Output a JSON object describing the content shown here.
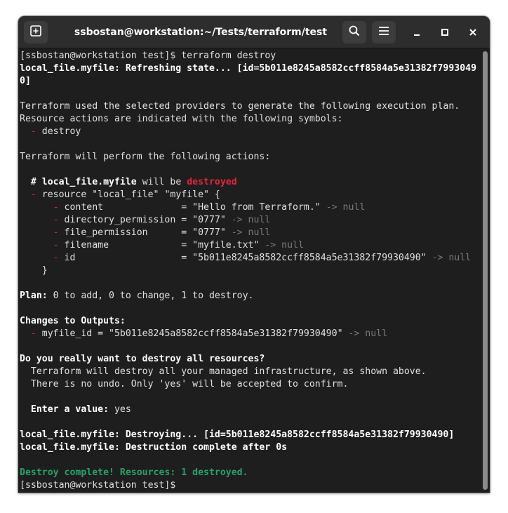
{
  "window": {
    "title": "ssbostan@workstation:~/Tests/terraform/test"
  },
  "icons": {
    "new_tab": "new-tab-icon",
    "search": "search-icon",
    "menu": "hamburger-menu-icon",
    "minimize": "minimize-icon",
    "maximize": "maximize-icon",
    "close": "close-icon"
  },
  "colors": {
    "terminal_bg": "#1e1e1e",
    "headerbar_bg": "#2d2d2d",
    "text": "#e0e0e0",
    "bold_text": "#ffffff",
    "red": "#e0283a",
    "dim": "#7a7a7a",
    "green": "#26a269"
  },
  "terminal": {
    "l01": "[ssbostan@workstation test]$ terraform destroy",
    "l02": "local_file.myfile: Refreshing state... [id=5b011e8245a8582ccff8584a5e31382f7993049",
    "l03": "0]",
    "l05": "Terraform used the selected providers to generate the following execution plan.",
    "l06": "Resource actions are indicated with the following symbols:",
    "l07_sym": "  -",
    "l07_text": " destroy",
    "l09": "Terraform will perform the following actions:",
    "l11_hash": "  # ",
    "l11_res": "local_file.myfile",
    "l11_mid": " will be ",
    "l11_state": "destroyed",
    "l12_sym": "  -",
    "l12_text": " resource \"local_file\" \"myfile\" {",
    "l13_sym": "      -",
    "l13_text": " content              = \"Hello from Terraform.\" ",
    "l13_null": "-> null",
    "l14_sym": "      -",
    "l14_text": " directory_permission = \"0777\" ",
    "l14_null": "-> null",
    "l15_sym": "      -",
    "l15_text": " file_permission      = \"0777\" ",
    "l15_null": "-> null",
    "l16_sym": "      -",
    "l16_text": " filename             = \"myfile.txt\" ",
    "l16_null": "-> null",
    "l17_sym": "      -",
    "l17_text": " id                   = \"5b011e8245a8582ccff8584a5e31382f79930490\" ",
    "l17_null": "-> null",
    "l18": "    }",
    "l20_label": "Plan:",
    "l20_text": " 0 to add, 0 to change, 1 to destroy.",
    "l22": "Changes to Outputs:",
    "l23_sym": "  -",
    "l23_text": " myfile_id = \"5b011e8245a8582ccff8584a5e31382f79930490\" ",
    "l23_null": "-> null",
    "l25": "Do you really want to destroy all resources?",
    "l26": "  Terraform will destroy all your managed infrastructure, as shown above.",
    "l27": "  There is no undo. Only 'yes' will be accepted to confirm.",
    "l29_label": "  Enter a value:",
    "l29_value": " yes",
    "l31": "local_file.myfile: Destroying... [id=5b011e8245a8582ccff8584a5e31382f79930490]",
    "l32": "local_file.myfile: Destruction complete after 0s",
    "l34": "Destroy complete! Resources: 1 destroyed.",
    "l35": "[ssbostan@workstation test]$ "
  }
}
